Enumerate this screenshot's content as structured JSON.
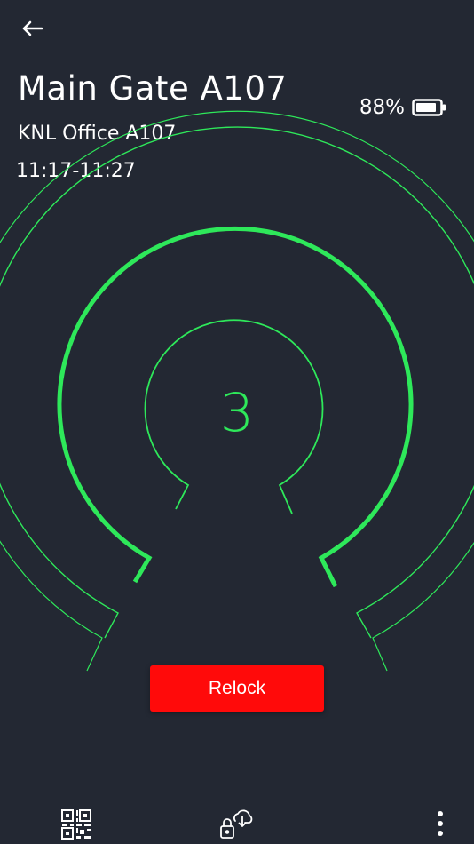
{
  "header": {
    "title": "Main Gate A107",
    "subtitle": "KNL Office A107",
    "time_range": "11:17-11:27"
  },
  "battery": {
    "level_text": "88%",
    "level": 0.88
  },
  "countdown": {
    "value": "3"
  },
  "actions": {
    "relock_label": "Relock"
  },
  "icons": {
    "back": "arrow-left-icon",
    "battery": "battery-icon",
    "qr": "qr-code-icon",
    "lock_cloud": "lock-cloud-sync-icon",
    "more": "more-vertical-icon"
  },
  "colors": {
    "background": "#232833",
    "accent_green": "#2ee85a",
    "relock_red": "#ff0a0a",
    "text": "#ffffff"
  }
}
